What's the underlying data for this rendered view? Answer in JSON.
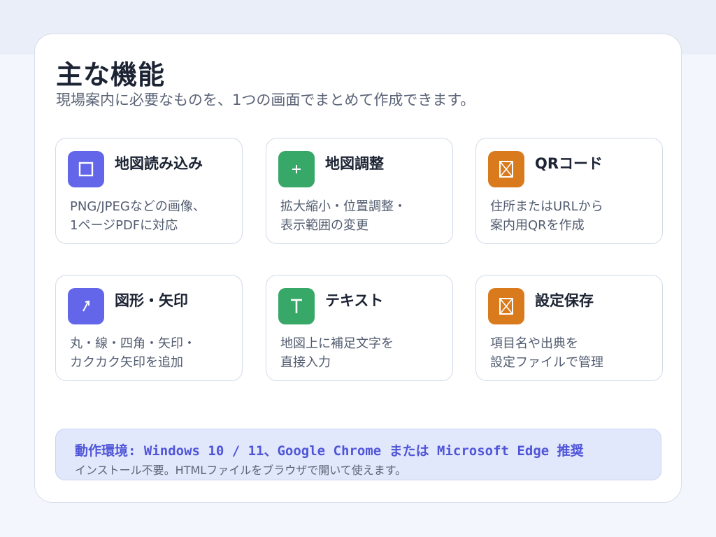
{
  "header": {
    "title": "主な機能",
    "subtitle": "現場案内に必要なものを、1つの画面でまとめて作成できます。"
  },
  "features": [
    {
      "title": "地図読み込み",
      "desc_lines": [
        "PNG/JPEGなどの画像、",
        "1ページPDFに対応"
      ],
      "icon": "square-frame-icon",
      "color": "#6366e8"
    },
    {
      "title": "地図調整",
      "desc_lines": [
        "拡大縮小・位置調整・",
        "表示範囲の変更"
      ],
      "icon": "plus-icon",
      "color": "#37a868"
    },
    {
      "title": "QRコード",
      "desc_lines": [
        "住所またはURLから",
        "案内用QRを作成"
      ],
      "icon": "qr-box-icon",
      "color": "#d97a1c"
    },
    {
      "title": "図形・矢印",
      "desc_lines": [
        "丸・線・四角・矢印・",
        "カクカク矢印を追加"
      ],
      "icon": "arrow-icon",
      "color": "#6366e8"
    },
    {
      "title": "テキスト",
      "desc_lines": [
        "地図上に補足文字を",
        "直接入力"
      ],
      "icon": "text-t-icon",
      "color": "#37a868"
    },
    {
      "title": "設定保存",
      "desc_lines": [
        "項目名や出典を",
        "設定ファイルで管理"
      ],
      "icon": "save-box-icon",
      "color": "#d97a1c"
    }
  ],
  "environment": {
    "requirement": "動作環境: Windows 10 / 11、Google Chrome または Microsoft Edge 推奨",
    "note": "インストール不要。HTMLファイルをブラウザで開いて使えます。"
  },
  "colors": {
    "accent": "#4f55d8",
    "purple": "#6366e8",
    "green": "#37a868",
    "orange": "#d97a1c"
  }
}
